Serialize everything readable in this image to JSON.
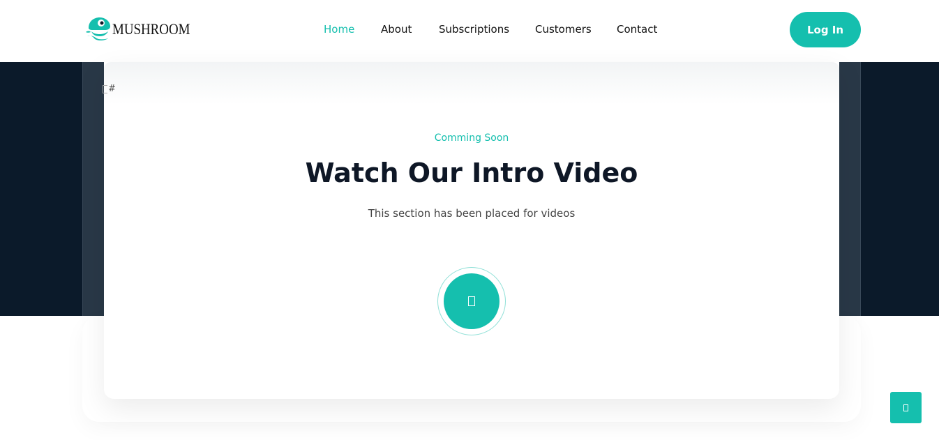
{
  "brand": {
    "name": "MUSHROOM",
    "logo_icon": "mushroom-logo-icon",
    "accent_color": "#15bfae",
    "dark_color": "#0b1a2a"
  },
  "nav": {
    "items": [
      {
        "label": "Home",
        "active": true
      },
      {
        "label": "About",
        "active": false
      },
      {
        "label": "Subscriptions",
        "active": false
      },
      {
        "label": "Customers",
        "active": false
      },
      {
        "label": "Contact",
        "active": false
      }
    ]
  },
  "header": {
    "login_label": "Log In"
  },
  "video_section": {
    "broken_image_alt": "#",
    "eyebrow": "Comming Soon",
    "title": "Watch Our Intro Video",
    "description": "This section has been placed for videos",
    "play_icon": "play-icon"
  },
  "floating": {
    "scroll_top_icon": "arrow-up-icon"
  }
}
